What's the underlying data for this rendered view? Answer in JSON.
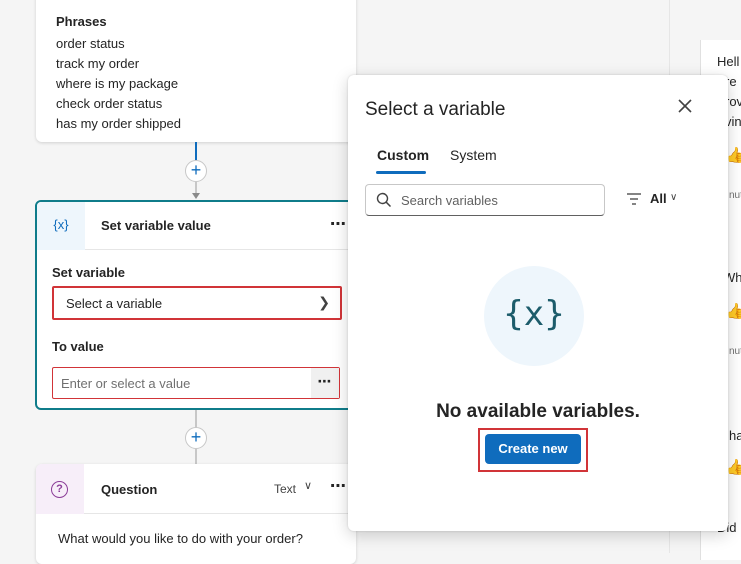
{
  "trigger": {
    "phrases_title": "Phrases",
    "phrases": [
      "order status",
      "track my order",
      "where is my package",
      "check order status",
      "has my order shipped"
    ]
  },
  "set_variable_node": {
    "icon_text": "{x}",
    "title": "Set variable value",
    "more": "⋯",
    "set_variable_label": "Set variable",
    "select_placeholder": "Select a variable",
    "to_value_label": "To value",
    "value_placeholder": "Enter or select a value",
    "value_more": "⋯"
  },
  "question_node": {
    "title": "Question",
    "type": "Text",
    "more": "⋯",
    "text": "What would you like to do with your order?"
  },
  "chat_fragments": [
    "Hell",
    "re",
    "rov",
    "vin",
    "nut",
    "Wha",
    "nut",
    "han",
    "Did"
  ],
  "variable_panel": {
    "title": "Select a variable",
    "tabs": [
      {
        "label": "Custom",
        "active": true
      },
      {
        "label": "System",
        "active": false
      }
    ],
    "search_placeholder": "Search variables",
    "filter_label": "All",
    "empty_icon_text": "{x}",
    "empty_message": "No available variables.",
    "create_button": "Create new"
  },
  "colors": {
    "accent": "#0f6cbd",
    "highlight_outline": "#d13438",
    "node_border": "#0f7c8a"
  }
}
